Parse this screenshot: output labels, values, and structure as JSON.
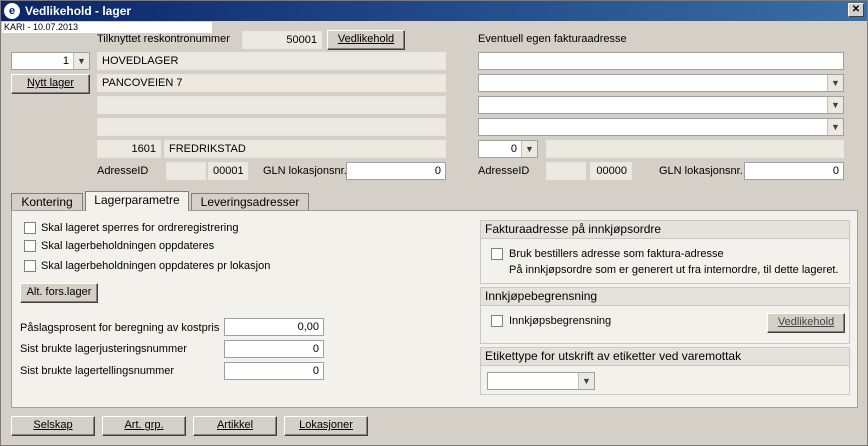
{
  "window": {
    "title": "Vedlikehold - lager",
    "app_icon": "e",
    "close": "✕",
    "user_date": "KARI - 10.07.2013"
  },
  "left": {
    "reskontro_label": "Tilknyttet reskontronummer",
    "reskontro_value": "50001",
    "vedlikehold_button": "Vedlikehold",
    "lager_select": "1",
    "new_lager_button": "Nytt lager",
    "name1": "HOVEDLAGER",
    "address1": "PANCOVEIEN 7",
    "address2": "",
    "address3": "",
    "postnr": "1601",
    "poststed": "FREDRIKSTAD",
    "adresse_id_label": "AdresseID",
    "adresse_id_value": "00001",
    "gln_label": "GLN lokasjonsnr.",
    "gln_value": "0"
  },
  "right": {
    "title": "Eventuell egen fakturaadresse",
    "name": "",
    "country_select": "0",
    "adresse_id_label": "AdresseID",
    "adresse_id_value": "00000",
    "gln_label": "GLN lokasjonsnr.",
    "gln_value": "0"
  },
  "tabs": [
    "Kontering",
    "Lagerparametre",
    "Leveringsadresser"
  ],
  "lagerparametre": {
    "chk1": "Skal lageret sperres for ordreregistrering",
    "chk2": "Skal lagerbeholdningen oppdateres",
    "chk3": "Skal lagerbeholdningen oppdateres pr lokasjon",
    "alt_button": "Alt. fors.lager",
    "paslag_label": "Påslagsprosent for beregning av kostpris",
    "paslag_value": "0,00",
    "justering_label": "Sist brukte lagerjusteringsnummer",
    "justering_value": "0",
    "telling_label": "Sist brukte lagertellingsnummer",
    "telling_value": "0"
  },
  "faktura_group": {
    "title": "Fakturaadresse på innkjøpsordre",
    "checkbox": "Bruk bestillers adresse som faktura-adresse",
    "note": "På innkjøpsordre som er generert ut fra internordre, til dette lageret."
  },
  "innkjop_group": {
    "title": "Innkjøpebegrensning",
    "checkbox": "Innkjøpsbegrensning",
    "button": "Vedlikehold"
  },
  "etikett_group": {
    "title": "Etikettype for utskrift av etiketter ved varemottak",
    "select": ""
  },
  "bottom_buttons": [
    "Selskap",
    "Art. grp.",
    "Artikkel",
    "Lokasjoner"
  ],
  "colors": {
    "titlebar": "#0a246a",
    "panel": "#f2f1ec",
    "window": "#d4d0c8"
  }
}
